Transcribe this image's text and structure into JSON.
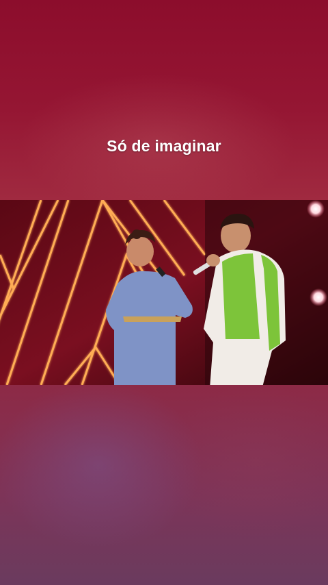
{
  "caption": {
    "text": "Só de imaginar"
  },
  "colors": {
    "background": "#8e1030",
    "caption_text": "#ffffff",
    "neon_line": "#ffb15a",
    "stage_red": "#6e0c1c",
    "jacket_green": "#7dc43a"
  },
  "video": {
    "scene": "stage-performance"
  }
}
